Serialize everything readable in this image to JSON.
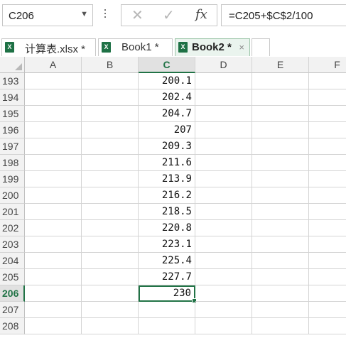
{
  "name_box": {
    "value": "C206"
  },
  "formula_bar": {
    "cancel_glyph": "✕",
    "enter_glyph": "✓",
    "fx_label": "fx",
    "formula": "=C205+$C$2/100"
  },
  "tabs": [
    {
      "label": "计算表.xlsx *",
      "active": false
    },
    {
      "label": "Book1 *",
      "active": false
    },
    {
      "label": "Book2 *",
      "active": true,
      "close": "×"
    }
  ],
  "columns": [
    "A",
    "B",
    "C",
    "D",
    "E",
    "F"
  ],
  "selected_column": "C",
  "rows": [
    {
      "num": "193",
      "c": "200.1"
    },
    {
      "num": "194",
      "c": "202.4"
    },
    {
      "num": "195",
      "c": "204.7"
    },
    {
      "num": "196",
      "c": "207"
    },
    {
      "num": "197",
      "c": "209.3"
    },
    {
      "num": "198",
      "c": "211.6"
    },
    {
      "num": "199",
      "c": "213.9"
    },
    {
      "num": "200",
      "c": "216.2"
    },
    {
      "num": "201",
      "c": "218.5"
    },
    {
      "num": "202",
      "c": "220.8"
    },
    {
      "num": "203",
      "c": "223.1"
    },
    {
      "num": "204",
      "c": "225.4"
    },
    {
      "num": "205",
      "c": "227.7"
    },
    {
      "num": "206",
      "c": "230"
    },
    {
      "num": "207",
      "c": ""
    },
    {
      "num": "208",
      "c": ""
    }
  ],
  "active_row": "206",
  "accent_color": "#217346"
}
